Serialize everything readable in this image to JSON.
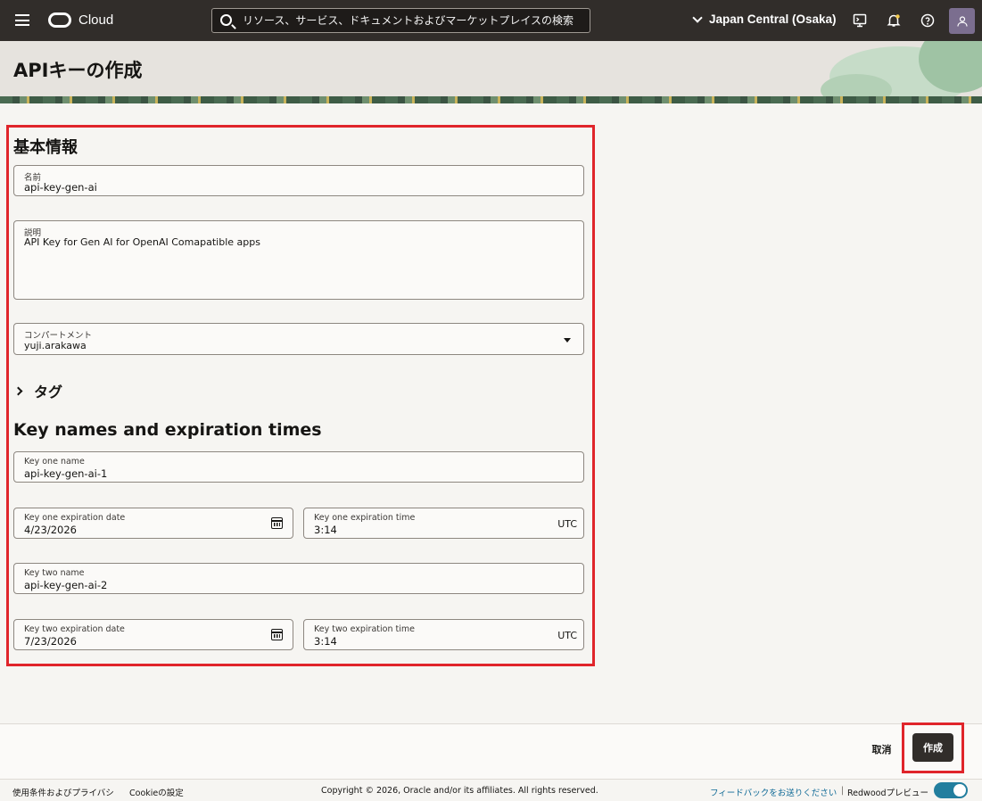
{
  "nav": {
    "brand": "Cloud",
    "search_placeholder": "リソース、サービス、ドキュメントおよびマーケットプレイスの検索",
    "region": "Japan Central (Osaka)",
    "icons": [
      "hamburger-icon",
      "oracle-logo",
      "search-icon",
      "chevron-down-icon",
      "cloud-shell-icon",
      "bell-icon",
      "help-icon",
      "user-icon"
    ]
  },
  "page": {
    "title": "APIキーの作成"
  },
  "basic": {
    "section_title": "基本情報",
    "name_label": "名前",
    "name_value": "api-key-gen-ai",
    "desc_label": "説明",
    "desc_value": "API Key for Gen AI for OpenAI Comapatible apps",
    "compartment_label": "コンパートメント",
    "compartment_value": "yuji.arakawa",
    "tags_label": "タグ"
  },
  "keys": {
    "section_title": "Key names and expiration times",
    "key1_name_label": "Key one name",
    "key1_name_value": "api-key-gen-ai-1",
    "key1_date_label": "Key one expiration date",
    "key1_date_value": "4/23/2026",
    "key1_time_label": "Key one expiration time",
    "key1_time_value": "3:14",
    "key2_name_label": "Key two name",
    "key2_name_value": "api-key-gen-ai-2",
    "key2_date_label": "Key two expiration date",
    "key2_date_value": "7/23/2026",
    "key2_time_label": "Key two expiration time",
    "key2_time_value": "3:14",
    "timezone": "UTC"
  },
  "actions": {
    "cancel_label": "取消",
    "create_label": "作成"
  },
  "footer": {
    "terms": "使用条件およびプライバシ",
    "cookies": "Cookieの設定",
    "copyright": "Copyright © 2026, Oracle and/or its affiliates. All rights reserved.",
    "feedback": "フィードバックをお送りください",
    "separator": "|",
    "redwood": "Redwoodプレビュー",
    "redwood_toggle_on": true
  },
  "colors": {
    "nav_bg": "#312d2a",
    "highlight_red": "#e0252b",
    "toggle_teal": "#227e9e"
  }
}
